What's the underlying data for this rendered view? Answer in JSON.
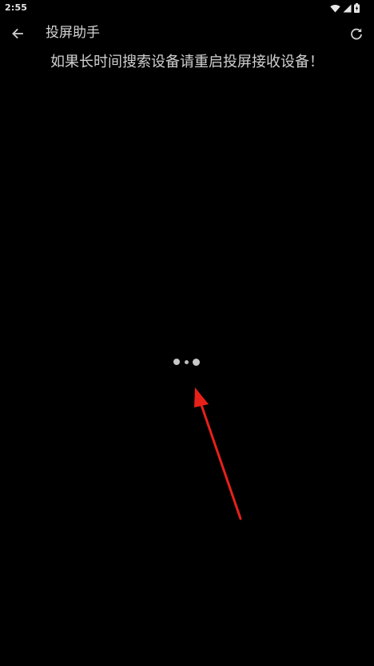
{
  "status_bar": {
    "time": "2:55",
    "icons": [
      "wifi-icon",
      "cellular-signal-icon",
      "battery-icon"
    ]
  },
  "app_bar": {
    "title": "投屏助手",
    "back_icon": "arrow-left-icon",
    "refresh_icon": "refresh-icon"
  },
  "main": {
    "hint": "如果长时间搜索设备请重启投屏接收设备！"
  },
  "colors": {
    "background": "#000000",
    "text": "#d0d0d0",
    "annotation_arrow": "#e8201a"
  }
}
